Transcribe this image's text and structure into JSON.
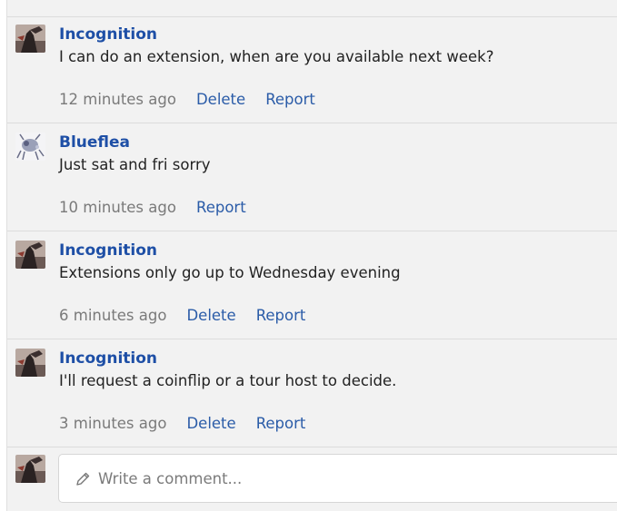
{
  "comments": [
    {
      "author": "Incognition",
      "avatar": "dark-figure-avatar",
      "text": "I can do an extension, when are you available next week?",
      "time": "12 minutes ago",
      "delete_label": "Delete",
      "report_label": "Report"
    },
    {
      "author": "Blueflea",
      "avatar": "flea-avatar",
      "text": "Just sat and fri sorry",
      "time": "10 minutes ago",
      "report_label": "Report"
    },
    {
      "author": "Incognition",
      "avatar": "dark-figure-avatar",
      "text": "Extensions only go up to Wednesday evening",
      "time": "6 minutes ago",
      "delete_label": "Delete",
      "report_label": "Report"
    },
    {
      "author": "Incognition",
      "avatar": "dark-figure-avatar",
      "text": "I'll request a coinflip or a tour host to decide.",
      "time": "3 minutes ago",
      "delete_label": "Delete",
      "report_label": "Report"
    }
  ],
  "composer": {
    "placeholder": "Write a comment...",
    "icon": "pencil-icon"
  },
  "colors": {
    "author": "#1e4fa6",
    "link": "#2b5ca8",
    "muted": "#7a7a7a",
    "panel_bg": "#f2f2f2"
  }
}
